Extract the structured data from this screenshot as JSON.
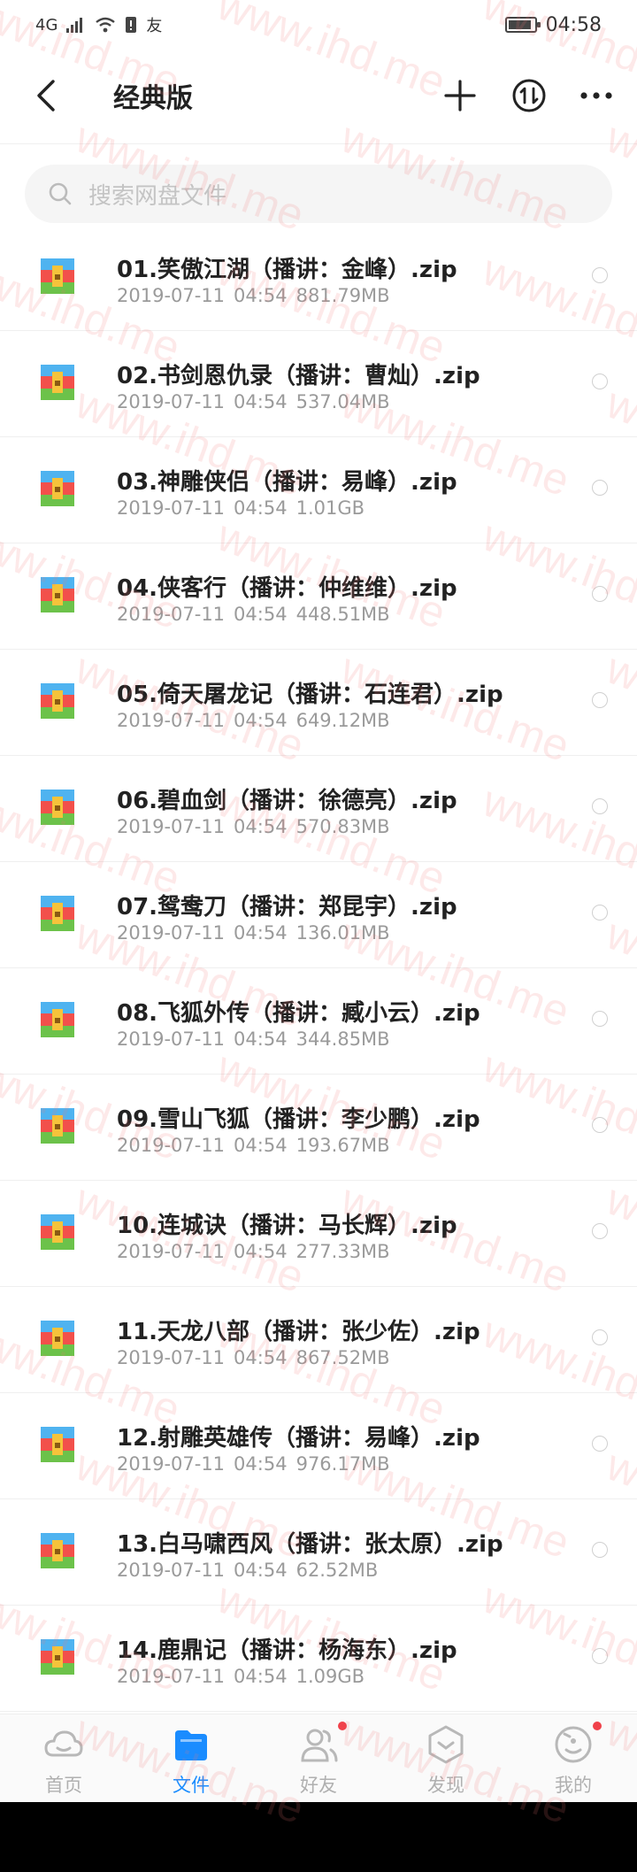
{
  "status_bar": {
    "network": "4G",
    "ime": "友",
    "time": "04:58",
    "battery_level": 0.9
  },
  "header": {
    "title": "经典版"
  },
  "search": {
    "placeholder": "搜索网盘文件"
  },
  "files": [
    {
      "name": "01.笑傲江湖（播讲：金峰）.zip",
      "date": "2019-07-11",
      "time": "04:54",
      "size": "881.79MB"
    },
    {
      "name": "02.书剑恩仇录（播讲：曹灿）.zip",
      "date": "2019-07-11",
      "time": "04:54",
      "size": "537.04MB"
    },
    {
      "name": "03.神雕侠侣（播讲：易峰）.zip",
      "date": "2019-07-11",
      "time": "04:54",
      "size": "1.01GB"
    },
    {
      "name": "04.侠客行（播讲：仲维维）.zip",
      "date": "2019-07-11",
      "time": "04:54",
      "size": "448.51MB"
    },
    {
      "name": "05.倚天屠龙记（播讲：石连君）.zip",
      "date": "2019-07-11",
      "time": "04:54",
      "size": "649.12MB"
    },
    {
      "name": "06.碧血剑（播讲：徐德亮）.zip",
      "date": "2019-07-11",
      "time": "04:54",
      "size": "570.83MB"
    },
    {
      "name": "07.鸳鸯刀（播讲：郑昆宇）.zip",
      "date": "2019-07-11",
      "time": "04:54",
      "size": "136.01MB"
    },
    {
      "name": "08.飞狐外传（播讲：臧小云）.zip",
      "date": "2019-07-11",
      "time": "04:54",
      "size": "344.85MB"
    },
    {
      "name": "09.雪山飞狐（播讲：李少鹏）.zip",
      "date": "2019-07-11",
      "time": "04:54",
      "size": "193.67MB"
    },
    {
      "name": "10.连城诀（播讲：马长辉）.zip",
      "date": "2019-07-11",
      "time": "04:54",
      "size": "277.33MB"
    },
    {
      "name": "11.天龙八部（播讲：张少佐）.zip",
      "date": "2019-07-11",
      "time": "04:54",
      "size": "867.52MB"
    },
    {
      "name": "12.射雕英雄传（播讲：易峰）.zip",
      "date": "2019-07-11",
      "time": "04:54",
      "size": "976.17MB"
    },
    {
      "name": "13.白马啸西风（播讲：张太原）.zip",
      "date": "2019-07-11",
      "time": "04:54",
      "size": "62.52MB"
    },
    {
      "name": "14.鹿鼎记（播讲：杨海东）.zip",
      "date": "2019-07-11",
      "time": "04:54",
      "size": "1.09GB"
    }
  ],
  "bottom_nav": [
    {
      "label": "首页",
      "icon": "cloud-icon",
      "active": false,
      "badge": false
    },
    {
      "label": "文件",
      "icon": "folder-icon",
      "active": true,
      "badge": false
    },
    {
      "label": "好友",
      "icon": "friends-icon",
      "active": false,
      "badge": true
    },
    {
      "label": "发现",
      "icon": "discover-icon",
      "active": false,
      "badge": false
    },
    {
      "label": "我的",
      "icon": "profile-icon",
      "active": false,
      "badge": true
    }
  ],
  "watermark": {
    "text": "www.ihd.me"
  },
  "colors": {
    "accent": "#1a8cff",
    "badge": "#f0414a",
    "watermark": "#f07878"
  }
}
